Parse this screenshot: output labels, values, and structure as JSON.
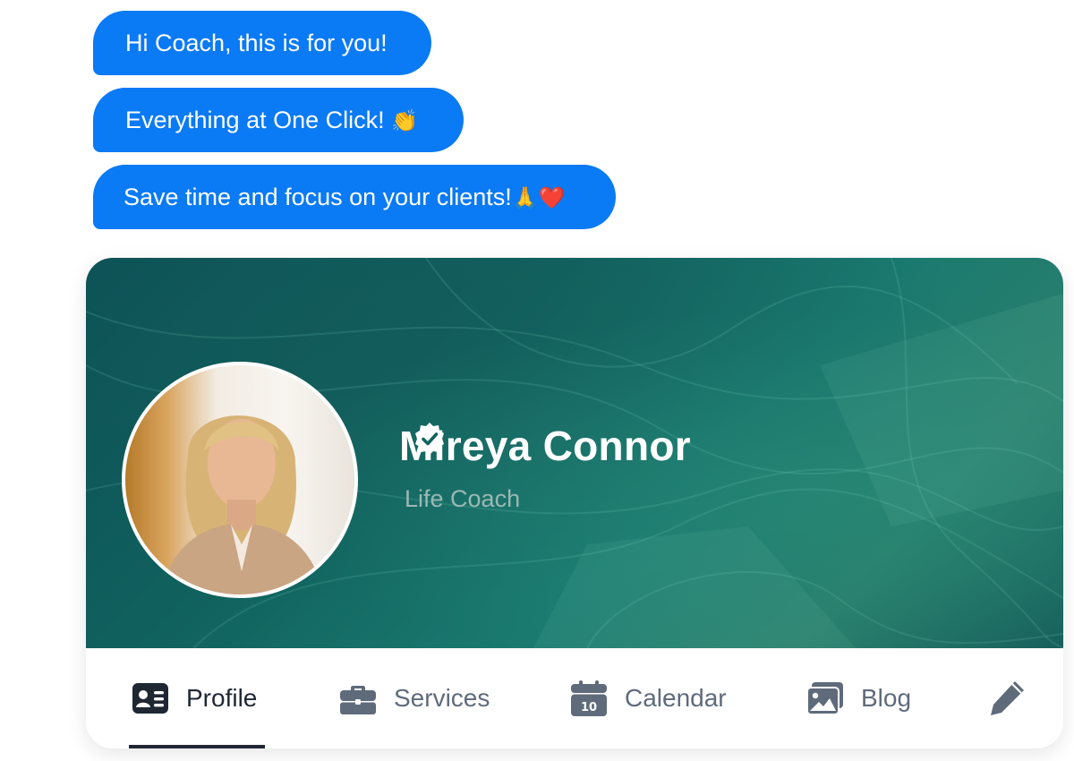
{
  "messages": [
    {
      "text": "Hi Coach, this is for you!",
      "emoji": ""
    },
    {
      "text": "Everything at One Click!",
      "emoji": "👏"
    },
    {
      "text": "Save time and focus on your clients!",
      "emoji": "🙏❤️"
    }
  ],
  "profile": {
    "name": "Mireya Connor",
    "title": "Life Coach",
    "verified": true
  },
  "tabs": [
    {
      "label": "Profile",
      "icon": "id-card-icon",
      "active": true
    },
    {
      "label": "Services",
      "icon": "briefcase-icon"
    },
    {
      "label": "Calendar",
      "icon": "calendar-icon",
      "icon_text": "10"
    },
    {
      "label": "Blog",
      "icon": "image-icon"
    },
    {
      "label": "",
      "icon": "pencil-icon"
    }
  ],
  "colors": {
    "bubble": "#0a7af5",
    "active_tab": "#1f2733",
    "inactive_tab": "#5f6b7b",
    "cover": "#11635f"
  }
}
